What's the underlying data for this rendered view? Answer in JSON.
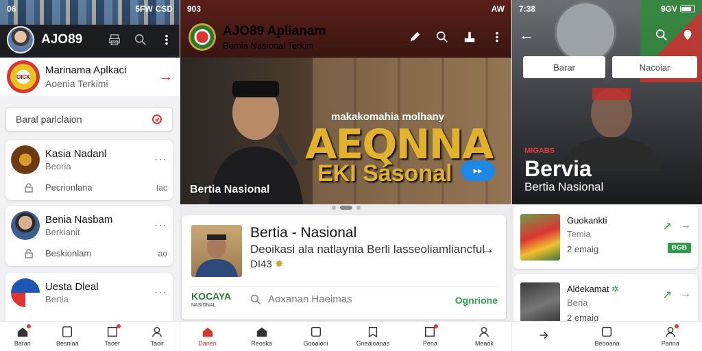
{
  "screen1": {
    "status_time": "06",
    "status_right": "5FW",
    "status_carrier": "CSD",
    "app_title": "AJO89",
    "promo_title": "Marinama Aplkaci",
    "promo_sub": "Aoenia Terkimi",
    "promo_logo": "OICK",
    "search_placeholder": "Baral parlclaion",
    "cards": [
      {
        "title": "Kasia Nadanl",
        "sub": "Beoria",
        "action": "Pecrionlana",
        "num": "tac"
      },
      {
        "title": "Benia Nasbam",
        "sub": "Berkianit",
        "action": "Beskionlam",
        "num": "ao"
      },
      {
        "title": "Uesta Dleal",
        "sub": "Bertia",
        "action": "",
        "num": ""
      }
    ],
    "nav": [
      "Baran",
      "Besniaa",
      "Taoer",
      "Taoir"
    ]
  },
  "screen2": {
    "status_time": "903",
    "status_right": "AW",
    "app_title": "AJO89 Aplianam",
    "app_sub": "Bemia Nasional Terkim",
    "hero_small": "makakomahia molhany",
    "hero_big": "AEQNNA",
    "hero_big2": "EKI Sásonal",
    "hero_label": "Bertia Nasional",
    "card_title": "Bertia - Nasional",
    "card_desc": "Deoikasi ala natlaynia Berli lasseoliamliancful",
    "card_desc2": "DI43",
    "brand": "KOCAYA",
    "brand_sub": "NASIONAL",
    "search_text": "Aoxanan Haeimas",
    "card_action": "Ognrione",
    "nav": [
      "Danen",
      "Reoska",
      "Gooaioni",
      "Gneaioanas",
      "Pena",
      "Meaok"
    ]
  },
  "screen3": {
    "status_time": "7:38",
    "status_right": "9GV",
    "chip1": "Barar",
    "chip2": "Nacoiar",
    "hero_small": "MIGABS",
    "hero_big": "Bervia",
    "hero_sub": "Bertia Nasional",
    "cards": [
      {
        "title": "Guokankti",
        "sub": "Temia",
        "meta": "2 emaig",
        "tag": "BGB"
      },
      {
        "title": "Aldekamat",
        "sub": "Beria",
        "meta": "2 emaig",
        "tag": ""
      }
    ],
    "nav": [
      "",
      "Beooana",
      "Panna"
    ]
  }
}
